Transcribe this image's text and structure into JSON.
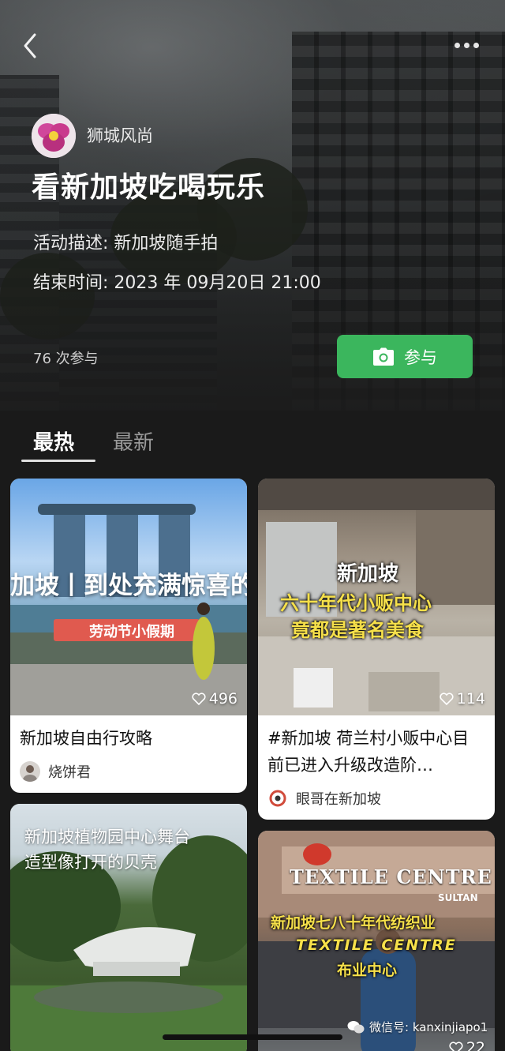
{
  "header": {
    "org_name": "狮城风尚",
    "title": "看新加坡吃喝玩乐",
    "description": "活动描述: 新加坡随手拍",
    "end_time": "结束时间: 2023 年 09月20日 21:00",
    "participants": "76 次参与",
    "join_label": "参与"
  },
  "tabs": [
    {
      "label": "最热",
      "active": true
    },
    {
      "label": "最新",
      "active": false
    }
  ],
  "cards": [
    {
      "overlay_line1": "加坡丨到处充满惊喜的城",
      "overlay_tag": "劳动节小假期",
      "likes": "496",
      "title": "新加坡自由行攻略",
      "author": "烧饼君"
    },
    {
      "overlay_line1": "新加坡",
      "overlay_line2": "六十年代小贩中心",
      "overlay_line3": "竟都是著名美食",
      "likes": "114",
      "title": "#新加坡 荷兰村小贩中心目前已进入升级改造阶…",
      "author": "眼哥在新加坡"
    },
    {
      "overlay_line1": "新加坡植物园中心舞台",
      "overlay_line2": "造型像打开的贝壳"
    },
    {
      "sign_text": "TEXTILE CENTRE",
      "sign_sub": "SULTAN",
      "overlay_line1": "新加坡七八十年代纺织业",
      "overlay_line2": "TEXTILE CENTRE",
      "overlay_line3": "布业中心",
      "likes_partial": "22"
    }
  ],
  "watermark": "微信号: kanxinjiapo1",
  "colors": {
    "join_green": "#3bb65d",
    "background": "#1a1a1a",
    "tag_red": "#e05a4f"
  }
}
